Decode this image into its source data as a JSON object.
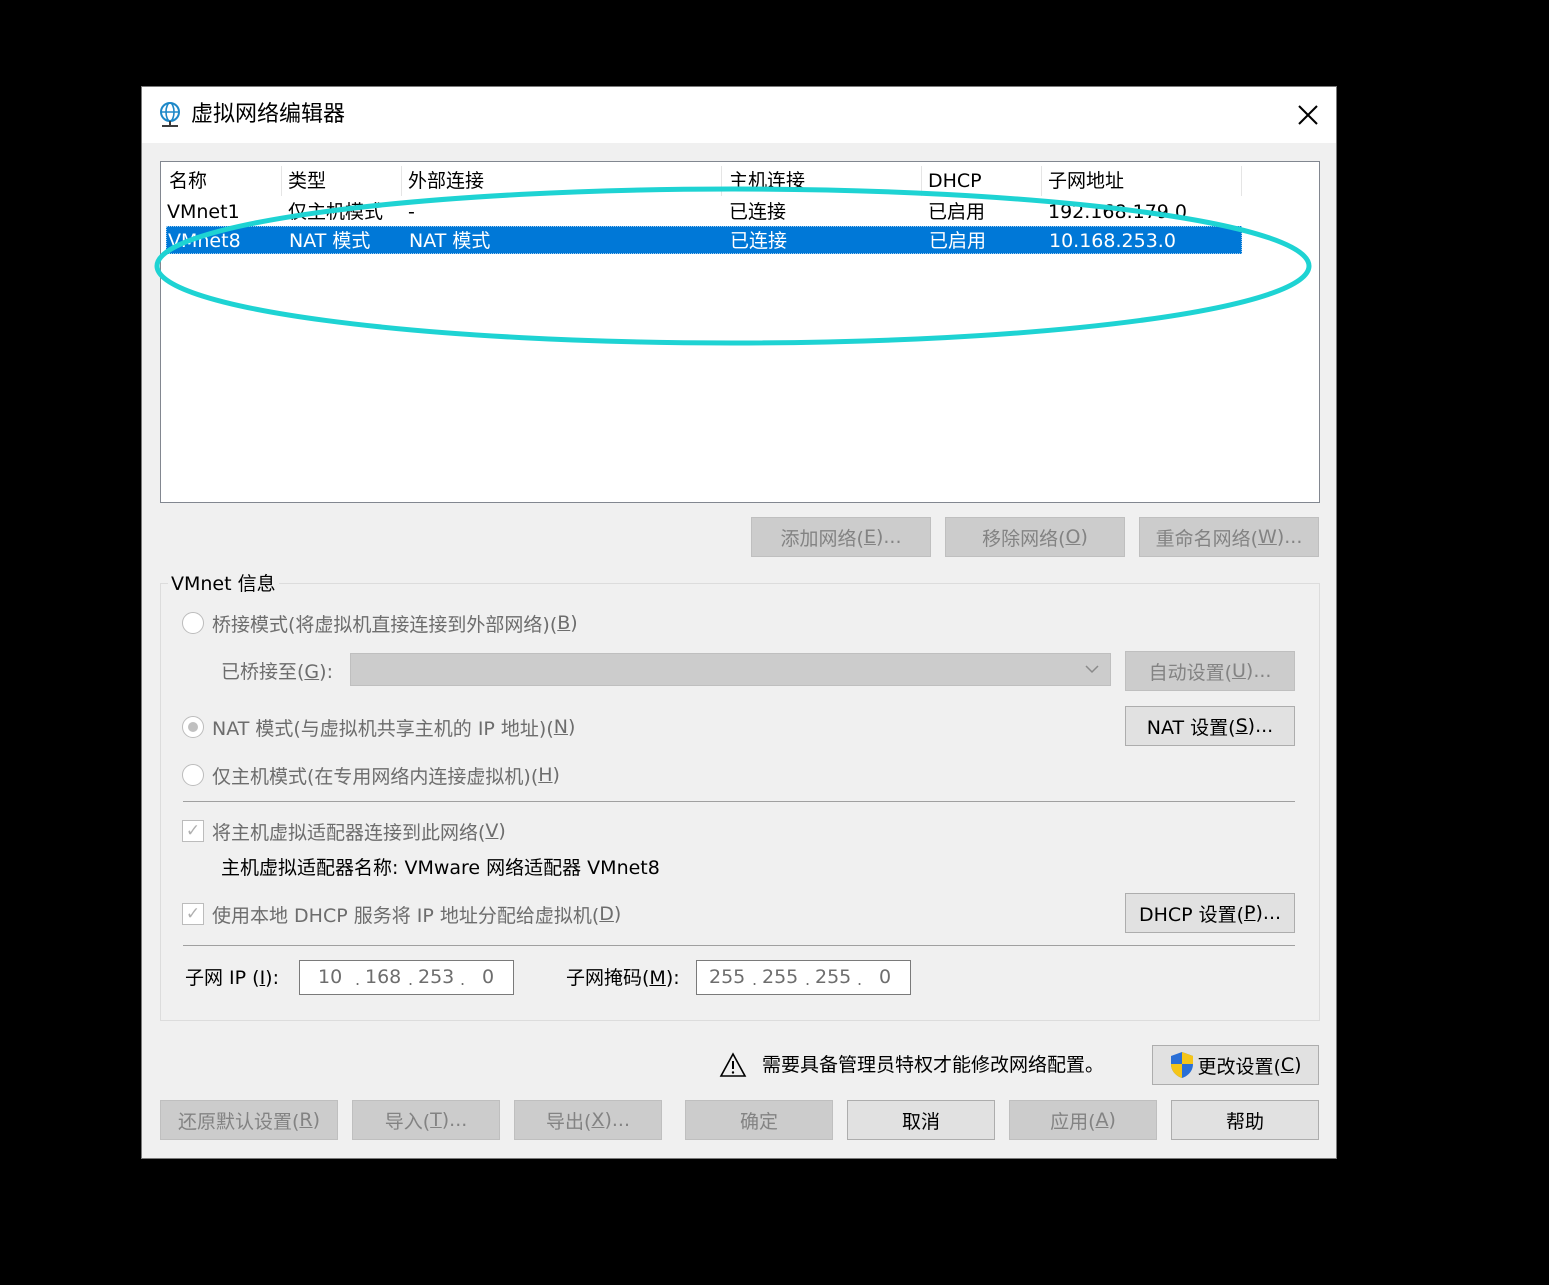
{
  "dialog": {
    "title": "虚拟网络编辑器",
    "close_label": "✕"
  },
  "list": {
    "columns": [
      "名称",
      "类型",
      "外部连接",
      "主机连接",
      "DHCP",
      "子网地址"
    ],
    "rows": [
      {
        "name": "VMnet1",
        "type": "仅主机模式",
        "external": "-",
        "host": "已连接",
        "dhcp": "已启用",
        "subnet": "192.168.179.0",
        "selected": false
      },
      {
        "name": "VMnet8",
        "type": "NAT 模式",
        "external": "NAT 模式",
        "host": "已连接",
        "dhcp": "已启用",
        "subnet": "10.168.253.0",
        "selected": true
      }
    ]
  },
  "list_buttons": {
    "add": {
      "pre": "添加网络(",
      "key": "E",
      "post": ")..."
    },
    "remove": {
      "pre": "移除网络(",
      "key": "O",
      "post": ")"
    },
    "rename": {
      "pre": "重命名网络(",
      "key": "W",
      "post": ")..."
    }
  },
  "vmnet_info": {
    "legend": "VMnet 信息",
    "bridged": {
      "pre": "桥接模式(将虚拟机直接连接到外部网络)(",
      "key": "B",
      "post": ")"
    },
    "bridged_to": {
      "pre": "已桥接至(",
      "key": "G",
      "post": "):"
    },
    "auto_settings": {
      "pre": "自动设置(",
      "key": "U",
      "post": ")..."
    },
    "nat": {
      "pre": "NAT 模式(与虚拟机共享主机的 IP 地址)(",
      "key": "N",
      "post": ")"
    },
    "nat_settings": {
      "pre": "NAT 设置(",
      "key": "S",
      "post": ")..."
    },
    "host_only": {
      "pre": "仅主机模式(在专用网络内连接虚拟机)(",
      "key": "H",
      "post": ")"
    },
    "connect_adapter": {
      "pre": "将主机虚拟适配器连接到此网络(",
      "key": "V",
      "post": ")"
    },
    "adapter_name": "主机虚拟适配器名称: VMware 网络适配器 VMnet8",
    "use_dhcp": {
      "pre": "使用本地 DHCP 服务将 IP 地址分配给虚拟机(",
      "key": "D",
      "post": ")"
    },
    "dhcp_settings": {
      "pre": "DHCP 设置(",
      "key": "P",
      "post": ")..."
    },
    "subnet_ip_label": {
      "pre": "子网 IP (",
      "key": "I",
      "post": "):"
    },
    "subnet_ip": [
      "10",
      "168",
      "253",
      "0"
    ],
    "subnet_mask_label": {
      "pre": "子网掩码(",
      "key": "M",
      "post": "):"
    },
    "subnet_mask": [
      "255",
      "255",
      "255",
      "0"
    ]
  },
  "admin": {
    "warning": "需要具备管理员特权才能修改网络配置。",
    "change": {
      "pre": "更改设置(",
      "key": "C",
      "post": ")"
    }
  },
  "footer": {
    "restore": {
      "pre": "还原默认设置(",
      "key": "R",
      "post": ")"
    },
    "import": {
      "pre": "导入(",
      "key": "T",
      "post": ")..."
    },
    "export": {
      "pre": "导出(",
      "key": "X",
      "post": ")..."
    },
    "ok": "确定",
    "cancel": "取消",
    "apply": {
      "pre": "应用(",
      "key": "A",
      "post": ")"
    },
    "help": "帮助"
  },
  "colors": {
    "selection": "#0078d7",
    "annotation_ellipse": "#1ed3d3",
    "dialog_bg": "#f0f0f0"
  }
}
